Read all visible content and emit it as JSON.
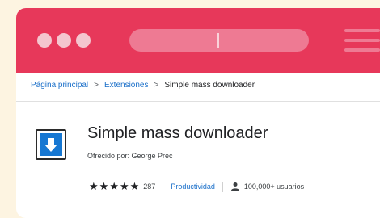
{
  "breadcrumb": {
    "home": "Página principal",
    "separator": ">",
    "extensions": "Extensiones",
    "current": "Simple mass downloader"
  },
  "extension": {
    "icon": "download-arrow-icon",
    "title": "Simple mass downloader",
    "offered_by": "Ofrecido por: George Prec",
    "rating_count": "287",
    "category": "Productividad",
    "users": "100,000+ usuarios"
  },
  "colors": {
    "title_bar": "#e7385a",
    "link": "#1a6fc9",
    "icon_blue": "#1677d2",
    "background": "#fdf4e1"
  }
}
